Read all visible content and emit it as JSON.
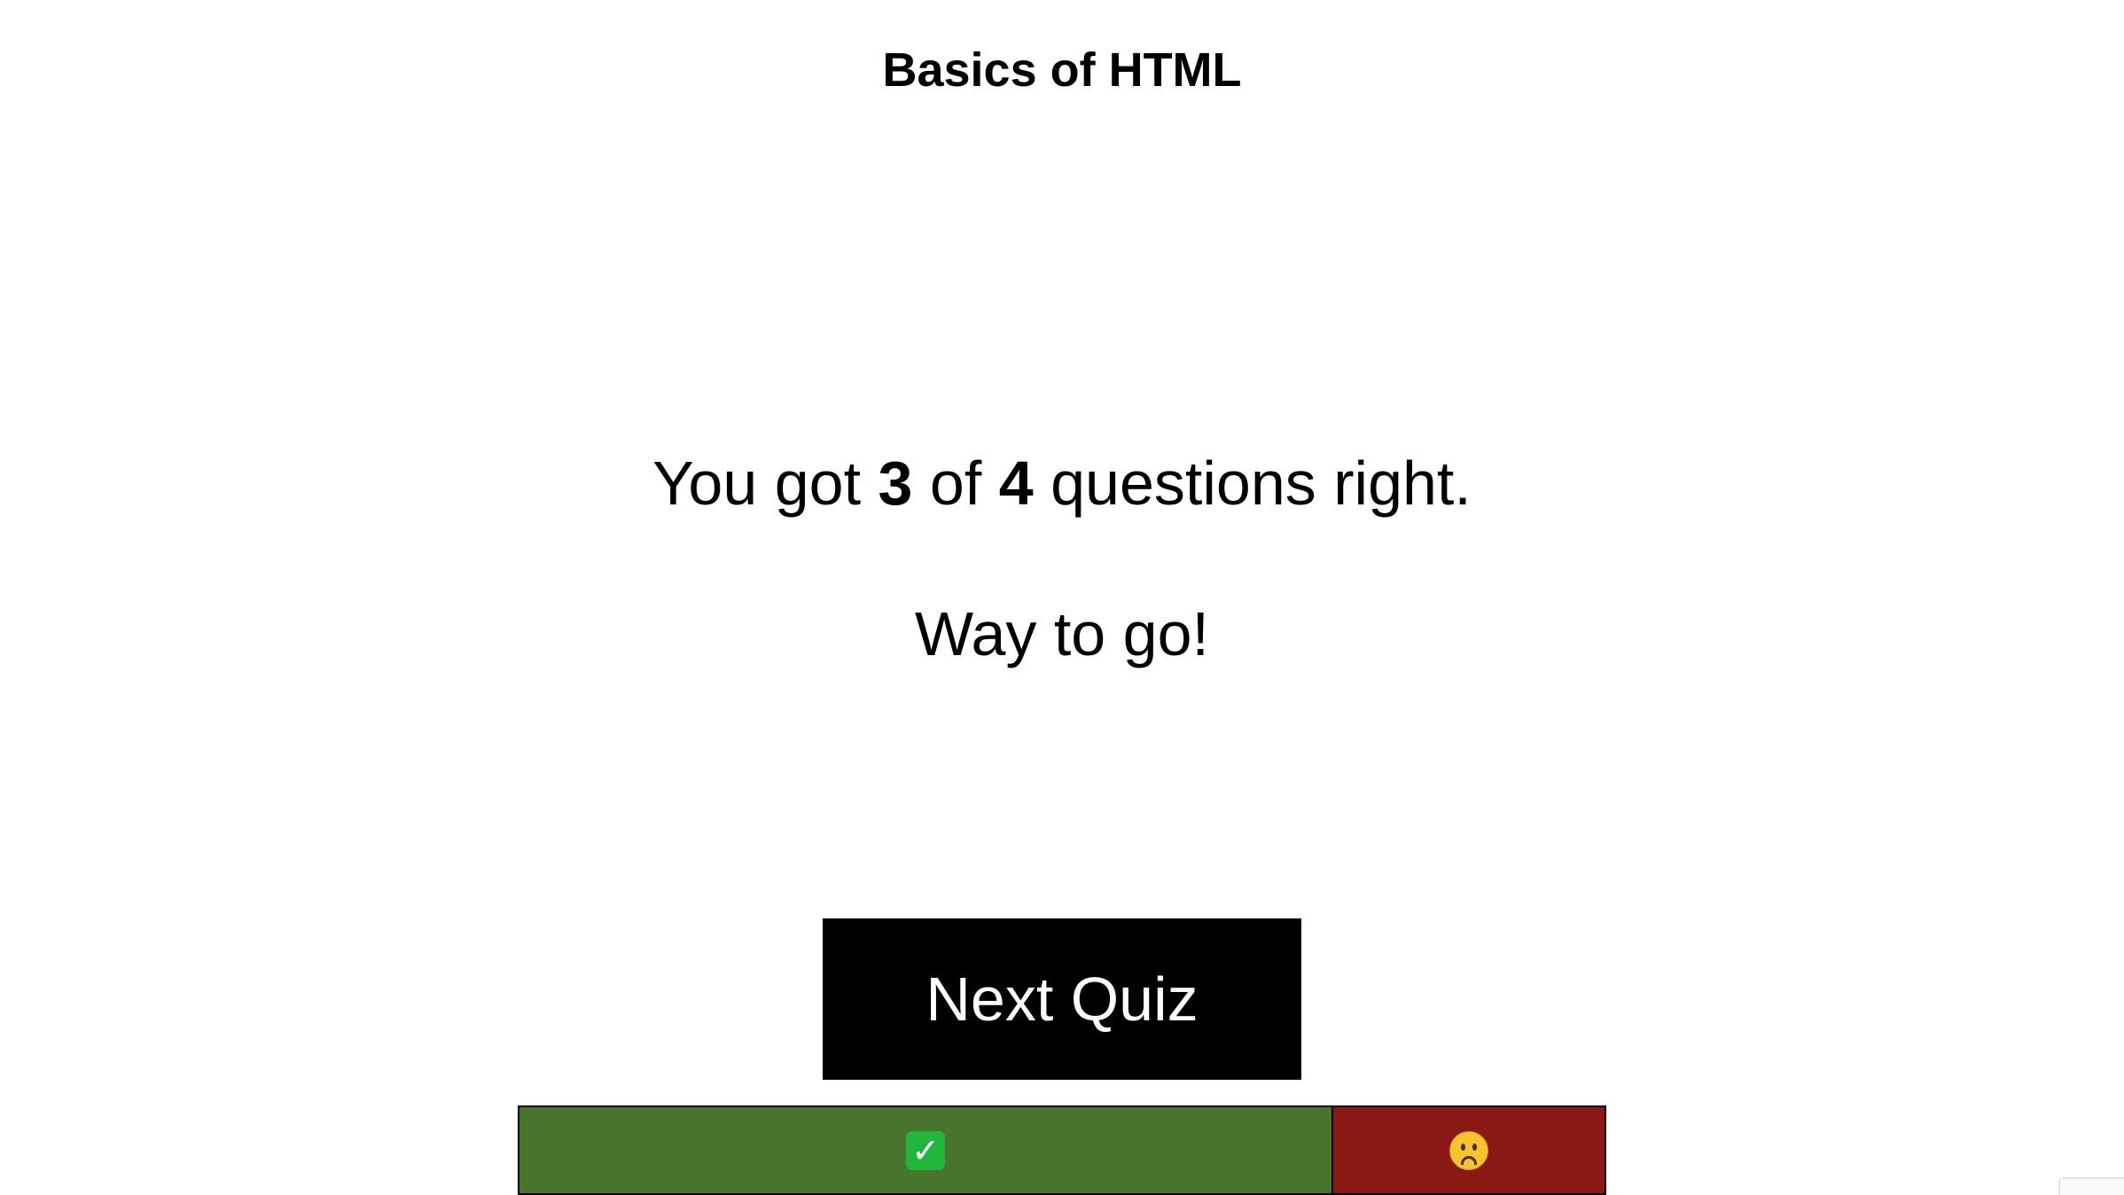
{
  "quiz": {
    "title": "Basics of HTML"
  },
  "result": {
    "prefix": "You got ",
    "correct": "3",
    "middle": " of ",
    "total": "4",
    "suffix": " questions right.",
    "message": "Way to go!"
  },
  "actions": {
    "next_label": "Next Quiz"
  },
  "score_bar": {
    "correct_count": 3,
    "wrong_count": 1,
    "correct_fraction": 0.75,
    "correct_color": "#48752c",
    "wrong_color": "#8a1914",
    "correct_icon": "check-mark-icon",
    "wrong_icon": "sad-face-icon"
  }
}
